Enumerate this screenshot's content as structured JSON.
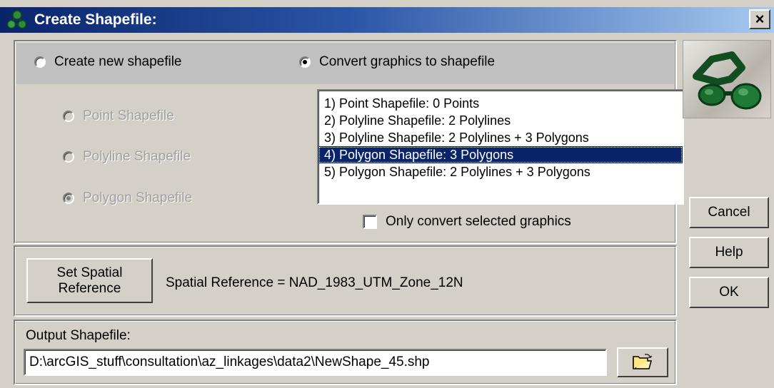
{
  "window": {
    "title": "Create Shapefile:",
    "close_label": "×"
  },
  "mode": {
    "create_new_label": "Create new shapefile",
    "convert_graphics_label": "Convert graphics to shapefile",
    "selected": "convert_graphics"
  },
  "shape_types": {
    "point_label": "Point Shapefile",
    "polyline_label": "Polyline Shapefile",
    "polygon_label": "Polygon Shapefile",
    "selected": "polygon",
    "enabled": false
  },
  "graphics_list": {
    "items": [
      "1) Point Shapefile: 0 Points",
      "2) Polyline Shapefile: 2 Polylines",
      "3) Polyline Shapefile: 2 Polylines + 3 Polygons",
      "4) Polygon Shapefile: 3 Polygons",
      "5) Polygon Shapefile: 2 Polylines + 3 Polygons"
    ],
    "selected_index": 3
  },
  "only_selected": {
    "label": "Only convert selected graphics",
    "checked": false
  },
  "spatial": {
    "button_label_line1": "Set Spatial",
    "button_label_line2": "Reference",
    "reference_text": "Spatial Reference = NAD_1983_UTM_Zone_12N"
  },
  "output": {
    "label": "Output Shapefile:",
    "path": "D:\\arcGIS_stuff\\consultation\\az_linkages\\data2\\NewShape_45.shp",
    "browse_icon": "open-folder-icon"
  },
  "buttons": {
    "cancel": "Cancel",
    "help": "Help",
    "ok": "OK"
  },
  "colors": {
    "titlebar_start": "#0a246a",
    "titlebar_end": "#a6caf0",
    "selection": "#0a246a",
    "face": "#d4d0c8"
  }
}
